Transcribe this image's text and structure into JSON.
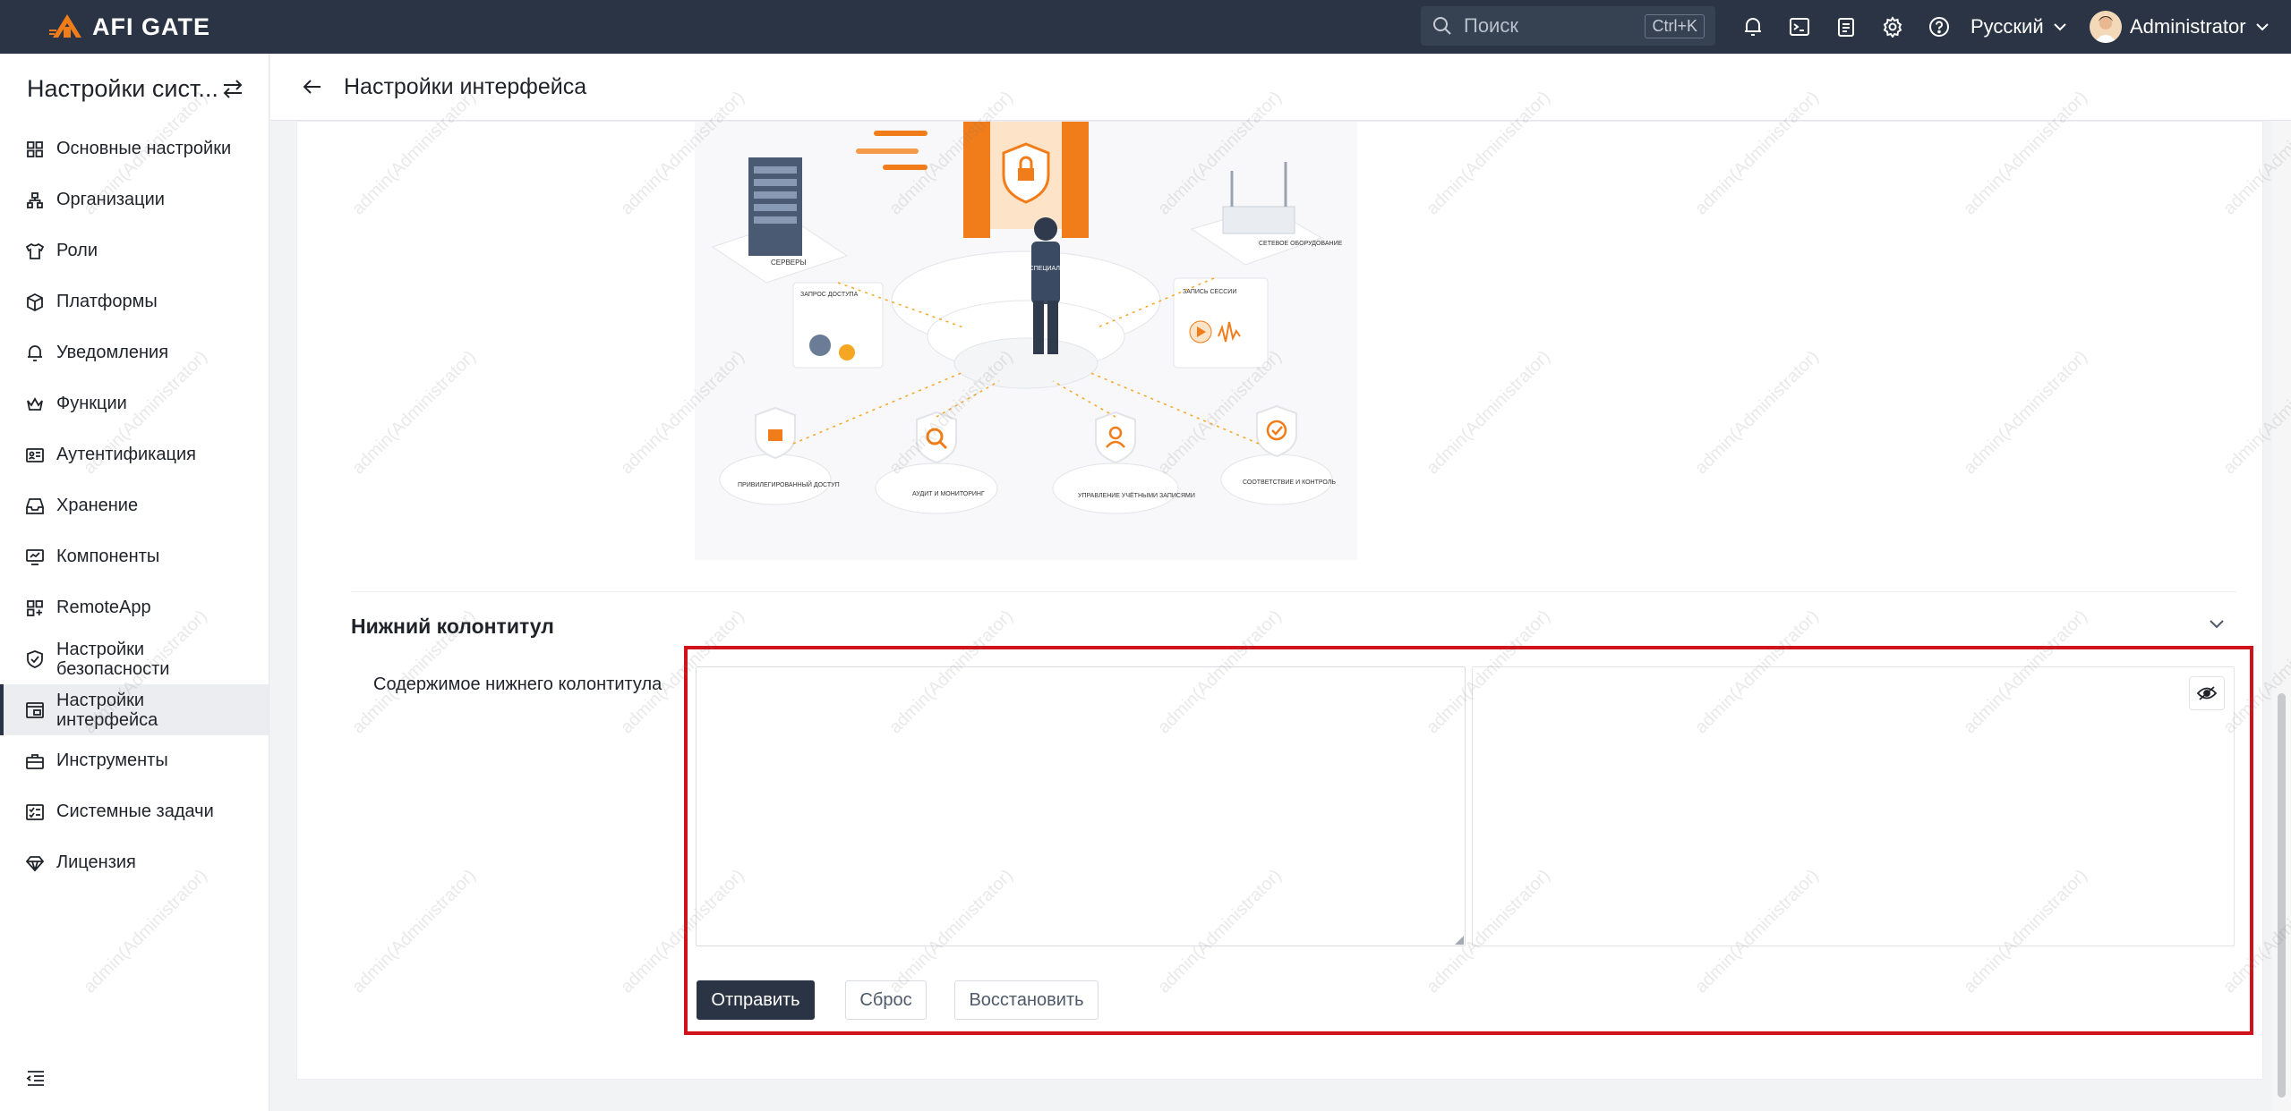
{
  "brand": {
    "name": "AFI GATE",
    "accent_color": "#f07d1a"
  },
  "topbar": {
    "search_placeholder": "Поиск",
    "search_shortcut": "Ctrl+K",
    "icons": [
      "bell-icon",
      "terminal-icon",
      "clipboard-icon",
      "gear-icon",
      "help-icon"
    ],
    "language": "Русский",
    "username": "Administrator",
    "bg_color": "#2a3444"
  },
  "sidebar": {
    "title": "Настройки сист...",
    "items": [
      {
        "label": "Основные настройки",
        "icon": "grid-icon"
      },
      {
        "label": "Организации",
        "icon": "org-tree-icon"
      },
      {
        "label": "Роли",
        "icon": "shirt-icon"
      },
      {
        "label": "Платформы",
        "icon": "cube-icon"
      },
      {
        "label": "Уведомления",
        "icon": "bell-icon"
      },
      {
        "label": "Функции",
        "icon": "crown-icon"
      },
      {
        "label": "Аутентификация",
        "icon": "id-card-icon"
      },
      {
        "label": "Хранение",
        "icon": "inbox-icon"
      },
      {
        "label": "Компоненты",
        "icon": "monitor-icon"
      },
      {
        "label": "RemoteApp",
        "icon": "apps-icon"
      },
      {
        "label": "Настройки безопасности",
        "icon": "shield-icon"
      },
      {
        "label": "Настройки интерфейса",
        "icon": "window-icon",
        "active": true
      },
      {
        "label": "Инструменты",
        "icon": "briefcase-icon"
      },
      {
        "label": "Системные задачи",
        "icon": "task-list-icon"
      },
      {
        "label": "Лицензия",
        "icon": "diamond-icon"
      }
    ]
  },
  "page": {
    "title": "Настройки интерфейса"
  },
  "illustration": {
    "labels": {
      "servers": "СЕРВЕРЫ",
      "network": "СЕТЕВОЕ ОБОРУДОВАНИЕ",
      "access_request": "ЗАПРОС ДОСТУПА",
      "session_record": "ЗАПИСЬ СЕССИИ",
      "specialist": "ИТ-СПЕЦИАЛИСТ",
      "privileged": "ПРИВИЛЕГИРОВАННЫЙ ДОСТУП",
      "audit": "АУДИТ И МОНИТОРИНГ",
      "accounts": "УПРАВЛЕНИЕ УЧЁТНЫМИ ЗАПИСЯМИ",
      "compliance": "СООТВЕТСТВИЕ И КОНТРОЛЬ"
    }
  },
  "footer_section": {
    "title": "Нижний колонтитул",
    "field_label": "Содержимое нижнего колонтитула",
    "editor_value": "",
    "submit_label": "Отправить",
    "reset_label": "Сброс",
    "restore_label": "Восстановить"
  },
  "watermark_text": "admin(Administrator)"
}
